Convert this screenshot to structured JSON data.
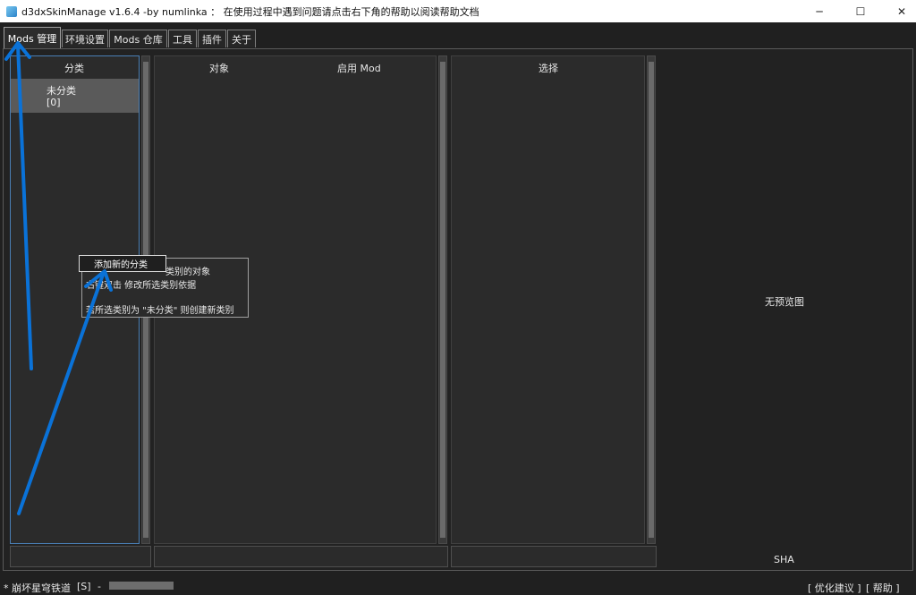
{
  "window": {
    "title": "d3dxSkinManage v1.6.4 -by numlinka ： 在使用过程中遇到问题请点击右下角的帮助以阅读帮助文档",
    "icon": "app-icon",
    "controls": {
      "minimize": "─",
      "maximize": "☐",
      "close": "✕"
    }
  },
  "tabs": [
    {
      "label": "Mods 管理",
      "active": true
    },
    {
      "label": "环境设置",
      "active": false
    },
    {
      "label": "Mods 仓库",
      "active": false
    },
    {
      "label": "工具",
      "active": false
    },
    {
      "label": "插件",
      "active": false
    },
    {
      "label": "关于",
      "active": false
    }
  ],
  "category_panel": {
    "header": "分类",
    "items": [
      {
        "name": "未分类",
        "count": "[0]"
      }
    ]
  },
  "object_panel": {
    "headers": {
      "object": "对象",
      "enabled_mod": "启用 Mod"
    }
  },
  "select_panel": {
    "header": "选择"
  },
  "preview": {
    "placeholder": "无预览图",
    "sha_label": "SHA"
  },
  "context_menu": {
    "add_category": "添加新的分类"
  },
  "tooltip": {
    "line1": "类别的对象",
    "line2": "右键双击 修改所选类别依据",
    "line3": "若所选类别为 \"未分类\" 则创建新类别"
  },
  "status_bar": {
    "game": "* 崩坏星穹铁道",
    "mode": "[S]",
    "separator": "-",
    "suggest_link": "[ 优化建议 ]",
    "help_link": "[ 帮助 ]"
  },
  "colors": {
    "annotation_arrow": "#0a72d8",
    "background": "#202020",
    "panel": "#2b2b2b",
    "selected_item": "#5a5a5a"
  }
}
